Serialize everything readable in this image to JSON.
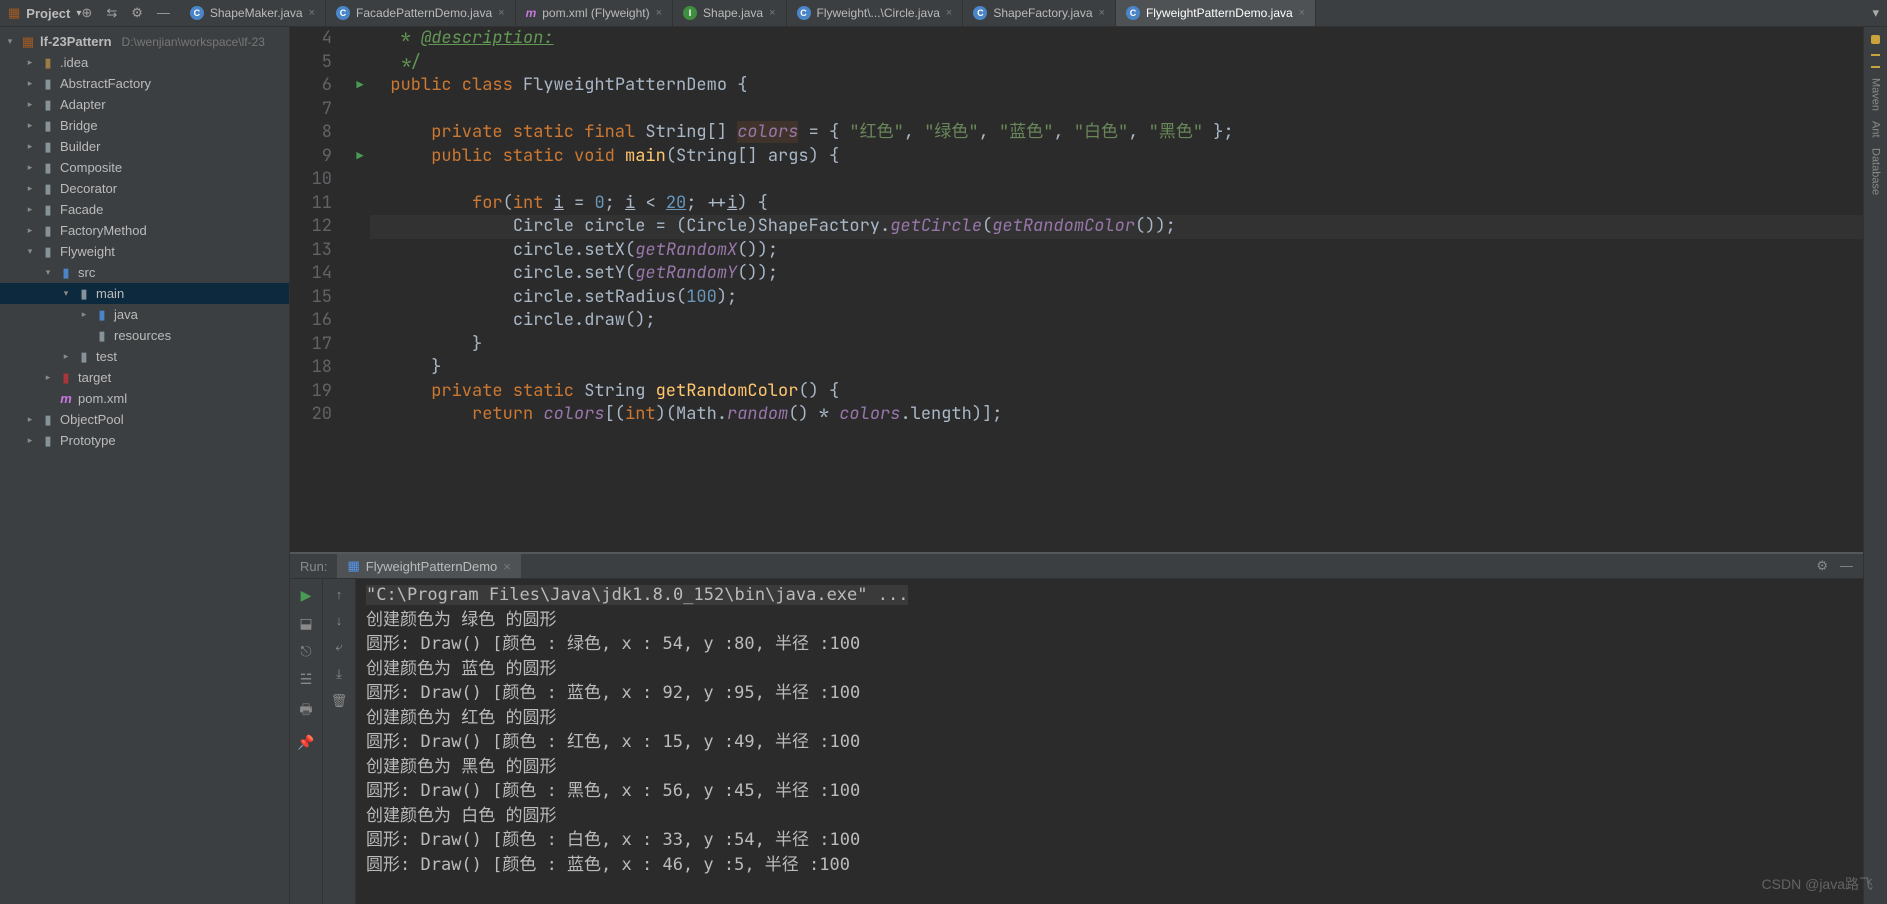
{
  "toolbar": {
    "project_label": "Project"
  },
  "tabs": [
    {
      "icon": "c",
      "label": "ShapeMaker.java"
    },
    {
      "icon": "c",
      "label": "FacadePatternDemo.java"
    },
    {
      "icon": "m",
      "label": "pom.xml (Flyweight)"
    },
    {
      "icon": "i",
      "label": "Shape.java"
    },
    {
      "icon": "c",
      "label": "Flyweight\\...\\Circle.java"
    },
    {
      "icon": "c",
      "label": "ShapeFactory.java"
    },
    {
      "icon": "c",
      "label": "FlyweightPatternDemo.java",
      "active": true
    }
  ],
  "tree": {
    "root": {
      "name": "lf-23Pattern",
      "path": "D:\\wenjian\\workspace\\lf-23"
    },
    "items": [
      {
        "depth": 1,
        "chev": "▸",
        "ico": "dir",
        "label": ".idea"
      },
      {
        "depth": 1,
        "chev": "▸",
        "ico": "folder",
        "label": "AbstractFactory"
      },
      {
        "depth": 1,
        "chev": "▸",
        "ico": "folder",
        "label": "Adapter"
      },
      {
        "depth": 1,
        "chev": "▸",
        "ico": "folder",
        "label": "Bridge"
      },
      {
        "depth": 1,
        "chev": "▸",
        "ico": "folder",
        "label": "Builder"
      },
      {
        "depth": 1,
        "chev": "▸",
        "ico": "folder",
        "label": "Composite"
      },
      {
        "depth": 1,
        "chev": "▸",
        "ico": "folder",
        "label": "Decorator"
      },
      {
        "depth": 1,
        "chev": "▸",
        "ico": "folder",
        "label": "Facade"
      },
      {
        "depth": 1,
        "chev": "▸",
        "ico": "folder",
        "label": "FactoryMethod"
      },
      {
        "depth": 1,
        "chev": "▾",
        "ico": "folder",
        "label": "Flyweight"
      },
      {
        "depth": 2,
        "chev": "▾",
        "ico": "folder-blue",
        "label": "src"
      },
      {
        "depth": 3,
        "chev": "▾",
        "ico": "folder",
        "label": "main",
        "selected": true
      },
      {
        "depth": 4,
        "chev": "▸",
        "ico": "folder-blue",
        "label": "java"
      },
      {
        "depth": 4,
        "chev": "",
        "ico": "folder",
        "label": "resources"
      },
      {
        "depth": 3,
        "chev": "▸",
        "ico": "folder",
        "label": "test"
      },
      {
        "depth": 2,
        "chev": "▸",
        "ico": "folder-red",
        "label": "target"
      },
      {
        "depth": 2,
        "chev": "",
        "ico": "xml",
        "label": "pom.xml"
      },
      {
        "depth": 1,
        "chev": "▸",
        "ico": "folder",
        "label": "ObjectPool"
      },
      {
        "depth": 1,
        "chev": "▸",
        "ico": "folder",
        "label": "Prototype"
      }
    ]
  },
  "editor": {
    "first_line_no": 4,
    "run_markers": [
      6,
      9
    ],
    "caret_line": 12,
    "code": {
      "class_name": "FlyweightPatternDemo",
      "colors_field": "colors",
      "colors": [
        "\"红色\"",
        "\"绿色\"",
        "\"蓝色\"",
        "\"白色\"",
        "\"黑色\""
      ],
      "loop_limit": "20",
      "radius": "100",
      "getRandomColor": "getRandomColor",
      "math_random": "random",
      "length": "length"
    }
  },
  "run": {
    "label": "Run:",
    "tab": "FlyweightPatternDemo",
    "console": [
      "\"C:\\Program Files\\Java\\jdk1.8.0_152\\bin\\java.exe\" ...",
      "创建颜色为 绿色 的圆形",
      "圆形: Draw() [颜色 : 绿色, x : 54, y :80, 半径 :100",
      "创建颜色为 蓝色 的圆形",
      "圆形: Draw() [颜色 : 蓝色, x : 92, y :95, 半径 :100",
      "创建颜色为 红色 的圆形",
      "圆形: Draw() [颜色 : 红色, x : 15, y :49, 半径 :100",
      "创建颜色为 黑色 的圆形",
      "圆形: Draw() [颜色 : 黑色, x : 56, y :45, 半径 :100",
      "创建颜色为 白色 的圆形",
      "圆形: Draw() [颜色 : 白色, x : 33, y :54, 半径 :100",
      "圆形: Draw() [颜色 : 蓝色, x : 46, y :5, 半径 :100"
    ]
  },
  "right_tools": [
    "Maven",
    "Ant",
    "Database"
  ],
  "watermark": "CSDN @java路飞"
}
